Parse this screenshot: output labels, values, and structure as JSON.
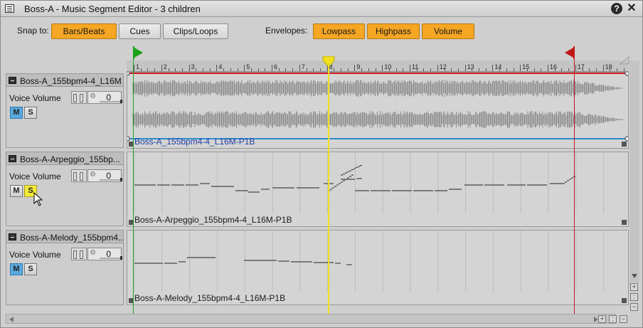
{
  "window": {
    "title": "Boss-A - Music Segment Editor - 3 children",
    "help_label": "?",
    "close_label": "✕"
  },
  "toolbar": {
    "snap_label": "Snap to:",
    "snap_buttons": [
      {
        "label": "Bars/Beats",
        "active": true
      },
      {
        "label": "Cues",
        "active": false
      },
      {
        "label": "Clips/Loops",
        "active": false
      }
    ],
    "envelopes_label": "Envelopes:",
    "envelope_buttons": [
      {
        "label": "Lowpass",
        "active": true
      },
      {
        "label": "Highpass",
        "active": true
      },
      {
        "label": "Volume",
        "active": true
      }
    ]
  },
  "ruler": {
    "bars": [
      "1",
      "2",
      "3",
      "4",
      "5",
      "6",
      "7",
      "8",
      "9",
      "10",
      "11",
      "12",
      "13",
      "14",
      "15",
      "16",
      "17",
      "18"
    ]
  },
  "markers": {
    "entry_color": "#1aa31a",
    "playhead_color": "#f0e020",
    "exit_color": "#c01818"
  },
  "tracks": [
    {
      "name": "Boss-A_155bpm4-4_L16M...",
      "voice_volume_label": "Voice Volume",
      "voice_volume_value": "0",
      "mute_label": "M",
      "solo_label": "S",
      "mute_on": true,
      "solo_on": false,
      "clip_label": "Boss-A_155bpm4-4_L16M-P1B"
    },
    {
      "name": "Boss-A-Arpeggio_155bp...",
      "voice_volume_label": "Voice Volume",
      "voice_volume_value": "0",
      "mute_label": "M",
      "solo_label": "S",
      "mute_on": false,
      "solo_on": true,
      "clip_label": "Boss-A-Arpeggio_155bpm4-4_L16M-P1B"
    },
    {
      "name": "Boss-A-Melody_155bpm4...",
      "voice_volume_label": "Voice Volume",
      "voice_volume_value": "0",
      "mute_label": "M",
      "solo_label": "S",
      "mute_on": true,
      "solo_on": false,
      "clip_label": "Boss-A-Melody_155bpm4-4_L16M-P1B"
    }
  ]
}
